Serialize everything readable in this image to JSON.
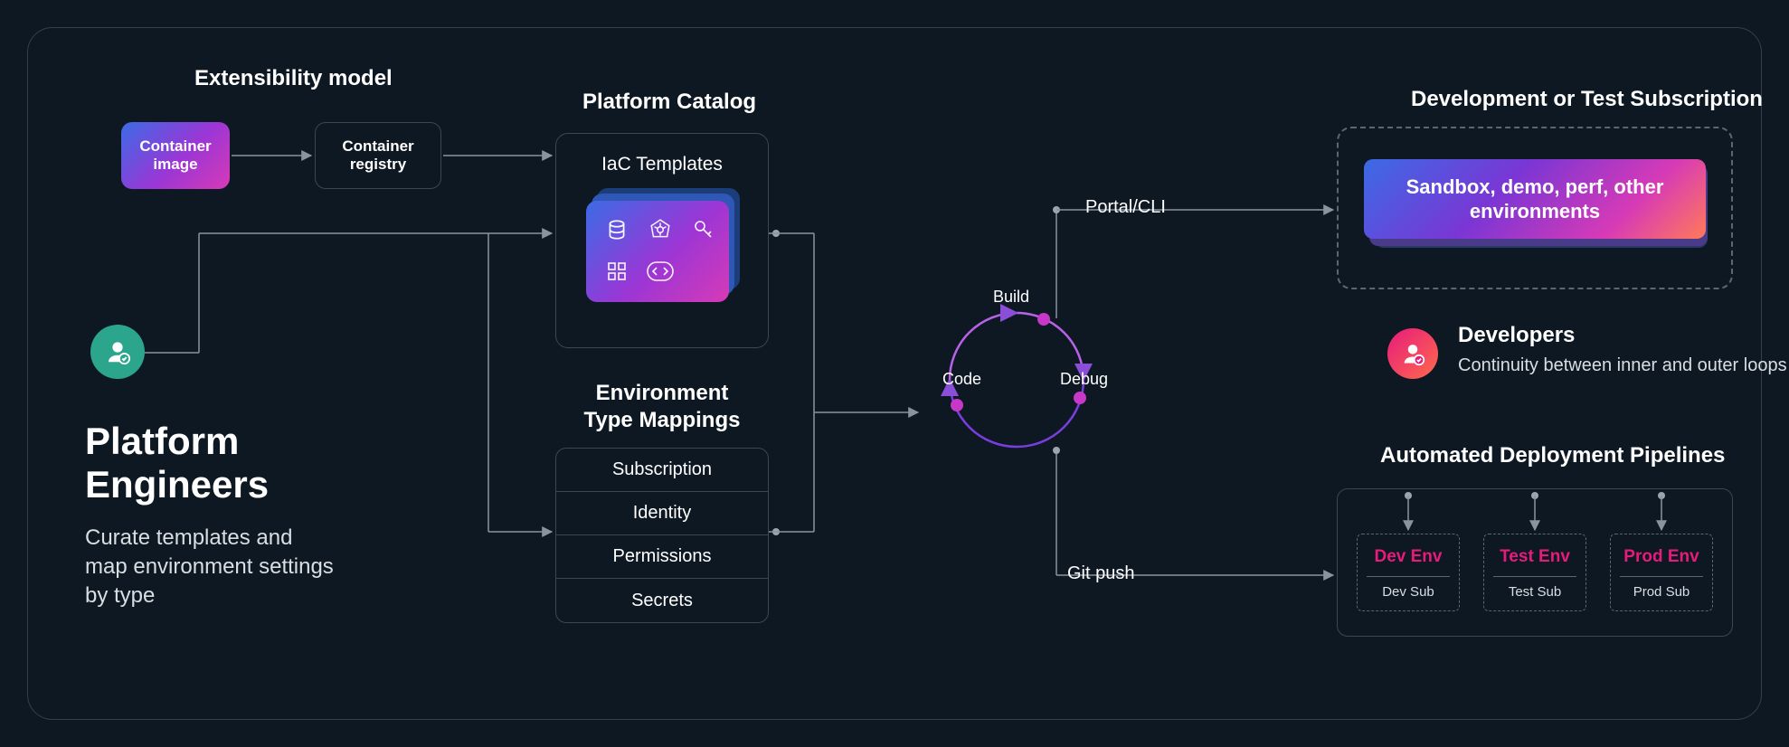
{
  "extensibility": {
    "title": "Extensibility model",
    "container_image": "Container image",
    "container_registry": "Container registry"
  },
  "catalog": {
    "title": "Platform Catalog",
    "iac_label": "IaC Templates"
  },
  "env_mappings": {
    "title": "Environment Type Mappings",
    "rows": [
      "Subscription",
      "Identity",
      "Permissions",
      "Secrets"
    ]
  },
  "persona": {
    "title_line1": "Platform",
    "title_line2": "Engineers",
    "description": "Curate templates and map environment settings by type"
  },
  "loop": {
    "build": "Build",
    "code": "Code",
    "debug": "Debug",
    "portal_label": "Portal/CLI",
    "gitpush_label": "Git push"
  },
  "developers": {
    "title": "Developers",
    "description": "Continuity between inner and outer loops"
  },
  "subscription": {
    "title": "Development or Test Subscription",
    "card": "Sandbox, demo, perf, other environments"
  },
  "pipelines": {
    "title": "Automated Deployment Pipelines",
    "envs": [
      {
        "name": "Dev Env",
        "sub": "Dev Sub"
      },
      {
        "name": "Test Env",
        "sub": "Test Sub"
      },
      {
        "name": "Prod Env",
        "sub": "Prod Sub"
      }
    ]
  }
}
